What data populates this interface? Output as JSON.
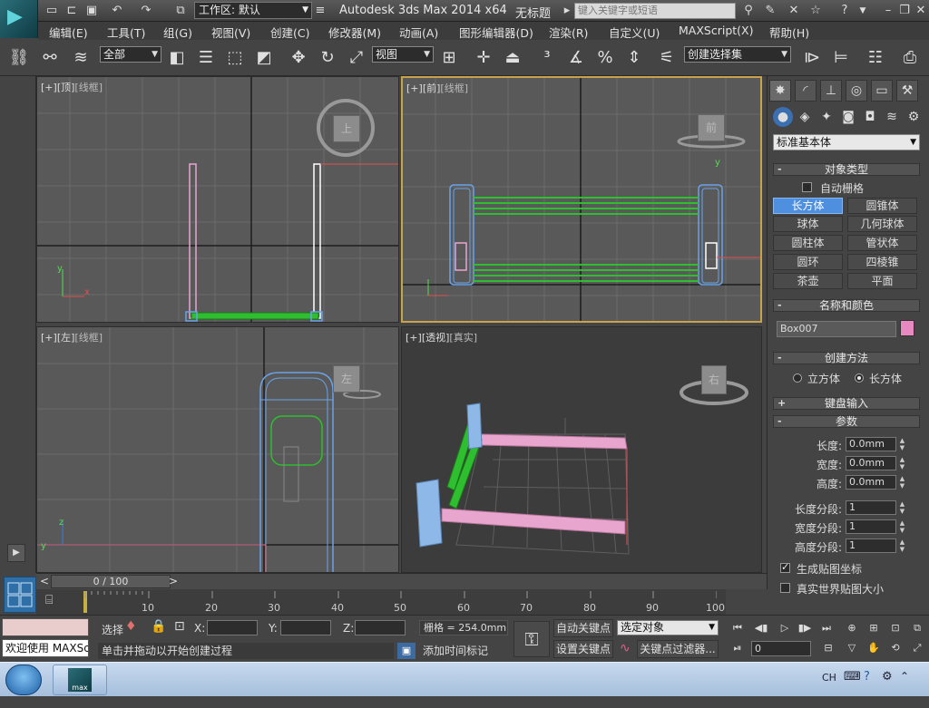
{
  "app": {
    "title": "Autodesk 3ds Max  2014 x64",
    "document": "无标题",
    "search_placeholder": "键入关键字或短语",
    "workspace": "工作区: 默认"
  },
  "menu": [
    "编辑(E)",
    "工具(T)",
    "组(G)",
    "视图(V)",
    "创建(C)",
    "修改器(M)",
    "动画(A)",
    "图形编辑器(D)",
    "渲染(R)",
    "自定义(U)",
    "MAXScript(X)",
    "帮助(H)"
  ],
  "toolbar": {
    "selection_filter": "全部",
    "ref_coord": "视图",
    "named_selection": "创建选择集"
  },
  "viewports": {
    "top": {
      "label_a": "[+]",
      "label_b": "[顶]",
      "label_c": "[线框]",
      "cube": "上"
    },
    "front": {
      "label_a": "[+]",
      "label_b": "[前]",
      "label_c": "[线框]",
      "cube": "前"
    },
    "left": {
      "label_a": "[+]",
      "label_b": "[左]",
      "label_c": "[线框]",
      "cube": "左"
    },
    "persp": {
      "label_a": "[+]",
      "label_b": "[透视]",
      "label_c": "[真实]",
      "cube": "右"
    }
  },
  "command_panel": {
    "category": "标准基本体",
    "object_type_title": "对象类型",
    "autogrid_label": "自动栅格",
    "object_buttons": [
      "长方体",
      "圆锥体",
      "球体",
      "几何球体",
      "圆柱体",
      "管状体",
      "圆环",
      "四棱锥",
      "茶壶",
      "平面"
    ],
    "active_object": "长方体",
    "name_color_title": "名称和颜色",
    "object_name": "Box007",
    "object_color": "#e889c2",
    "creation_method_title": "创建方法",
    "method_cube": "立方体",
    "method_box": "长方体",
    "keyboard_entry_title": "键盘输入",
    "params_title": "参数",
    "length_label": "长度:",
    "length_value": "0.0mm",
    "width_label": "宽度:",
    "width_value": "0.0mm",
    "height_label": "高度:",
    "height_value": "0.0mm",
    "length_segs_label": "长度分段:",
    "length_segs_value": "1",
    "width_segs_label": "宽度分段:",
    "width_segs_value": "1",
    "height_segs_label": "高度分段:",
    "height_segs_value": "1",
    "gen_map_coords": "生成贴图坐标",
    "real_world_map": "真实世界贴图大小"
  },
  "timeline": {
    "frame_display": "0 / 100",
    "ticks": [
      "10",
      "20",
      "30",
      "40",
      "50",
      "60",
      "70",
      "80",
      "90",
      "100"
    ]
  },
  "status": {
    "maxscript_listener": "欢迎使用 MAXSc",
    "selected_label": "选择",
    "x_label": "X:",
    "y_label": "Y:",
    "z_label": "Z:",
    "grid": "栅格 = 254.0mm",
    "prompt": "单击并拖动以开始创建过程",
    "add_time_tag": "添加时间标记",
    "auto_key": "自动关键点",
    "set_key": "设置关键点",
    "key_mode": "选定对象",
    "key_filters": "关键点过滤器...",
    "current_frame": "0"
  },
  "taskbar": {
    "lang": "CH",
    "app_button": "max"
  },
  "colors": {
    "accent_active_viewport": "#c9a34a",
    "selected_button": "#4f8fe0",
    "rail_green": "#2fbe2f",
    "post_blue": "#6aa3e8",
    "board_pink": "#e8a6cf"
  }
}
